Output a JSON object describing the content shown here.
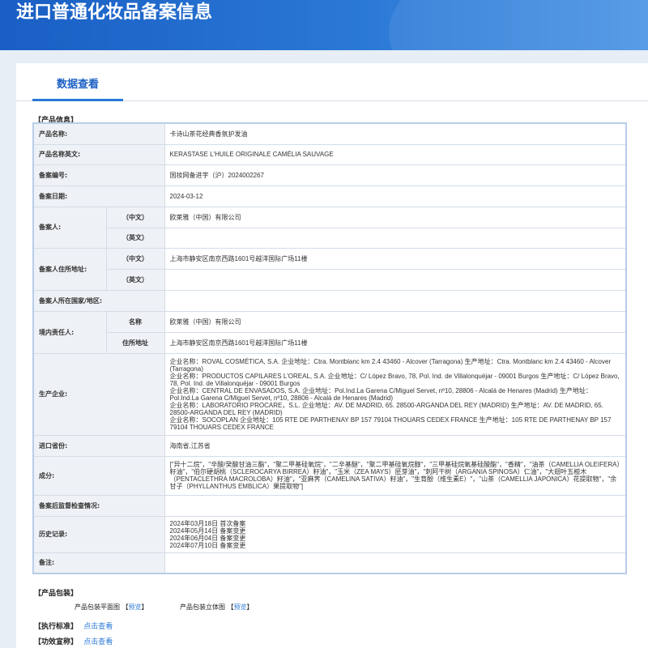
{
  "header": {
    "title": "进口普通化妆品备案信息"
  },
  "tabs": [
    {
      "label": "数据查看"
    }
  ],
  "product_section": {
    "heading": "产品信息"
  },
  "rows": {
    "name_label": "产品名称:",
    "name": "卡诗山茶花经典香氛护发油",
    "name_en_label": "产品名称英文:",
    "name_en": "KERASTASE L'HUILE ORIGINALE CAMÉLIA SAUVAGE",
    "reg_no_label": "备案编号:",
    "reg_no": "国妆网备进字（沪）2024002267",
    "reg_date_label": "备案日期:",
    "reg_date": "2024-03-12",
    "registrant_label": "备案人:",
    "cn_label": "（中文）",
    "en_label": "（英文）",
    "registrant_cn": "欧莱雅（中国）有限公司",
    "registrant_en": "",
    "registrant_addr_label": "备案人住所地址:",
    "registrant_addr_cn": "上海市静安区南京西路1601号越洋国际广场11楼",
    "registrant_addr_en": "",
    "country_label": "备案人所在国家/地区:",
    "country": "",
    "domestic_label": "境内责任人:",
    "domestic_name_label": "名称",
    "domestic_name": "欧莱雅（中国）有限公司",
    "domestic_addr_label": "住所地址",
    "domestic_addr": "上海市静安区南京西路1601号越洋国际广场11楼",
    "producer_label": "生产企业:",
    "producers": [
      "企业名称：ROVAL COSMÉTICA, S.A. 企业地址：Ctra. Montblanc km 2.4 43460 - Alcover (Tarragona) 生产地址：Ctra. Montblanc km 2.4 43460 - Alcover (Tarragona)",
      "企业名称：PRODUCTOS CAPILARES L'OREAL, S.A. 企业地址：C/ López Bravo, 78, Pol. Ind. de Villalonquéjar - 09001 Burgos 生产地址：C/ López Bravo, 78, Pol. Ind. de Villalonquéjar - 09001 Burgos",
      "企业名称：CENTRAL DE ENVASADOS, S.A. 企业地址：Pol.Ind.La Garena C/Miguel Servet, nº10, 28806 - Alcalá de Henares (Madrid) 生产地址：Pol.Ind.La Garena C/Miguel Servet, nº10, 28806 - Alcalá de Henares (Madrid)",
      "企业名称：LABORATORIO PROCARE，S.L. 企业地址：AV. DE MADRID, 65. 28500-ARGANDA DEL REY (MADRID) 生产地址：AV. DE MADRID, 65. 28500-ARGANDA DEL REY (MADRID)",
      "企业名称：SOCOPLAN 企业地址：105 RTE DE PARTHENAY BP 157 79104 THOUARS CEDEX FRANCE 生产地址：105 RTE DE PARTHENAY BP 157 79104 THOUARS CEDEX FRANCE"
    ],
    "province_label": "进口省份:",
    "province": "海南省,江苏省",
    "ingredients_label": "成分:",
    "ingredients": "[\"异十二烷\"，\"辛酸/癸酸甘油三酯\"，\"聚二甲基硅氧烷\"，\"二辛基醚\"，\"聚二甲基硅氧烷醇\"，\"三甲基硅烷氧基硅酸酯\"，\"香精\"，\"油茶（CAMELLIA OLEIFERA）籽油\"，\"伯尔硬胡桃（SCLEROCARYA BIRREA）籽油\"，\"玉米（ZEA MAYS）胚芽油\"，\"刺阿干树（ARGANIA SPINOSA）仁油\"，\"大翅叶五桠木（PENTACLETHRA MACROLOBA）籽油\"，\"亚麻荠（CAMELINA SATIVA）籽油\"，\"生育酚（维生素E）\"，\"山茶（CAMELLIA JAPONICA）花提取物\"，\"余甘子（PHYLLANTHUS EMBLICA）果提取物\"]",
    "inspection_label": "备案后监督检查情况:",
    "inspection": "",
    "history_label": "历史记录:",
    "history": [
      "2024年03月18日 首次备案",
      "2024年05月14日 备案变更",
      "2024年06月04日 备案变更",
      "2024年07月10日 备案变更"
    ],
    "remark_label": "备注:",
    "remark": ""
  },
  "packaging": {
    "heading": "产品包装",
    "flat_label": "产品包装平面图",
    "flat_link": "预览",
    "solid_label": "产品包装立体图",
    "solid_link": "预览"
  },
  "standard": {
    "heading": "执行标准",
    "link": "点击查看"
  },
  "efficacy": {
    "heading": "功效宣称",
    "link": "点击查看"
  }
}
